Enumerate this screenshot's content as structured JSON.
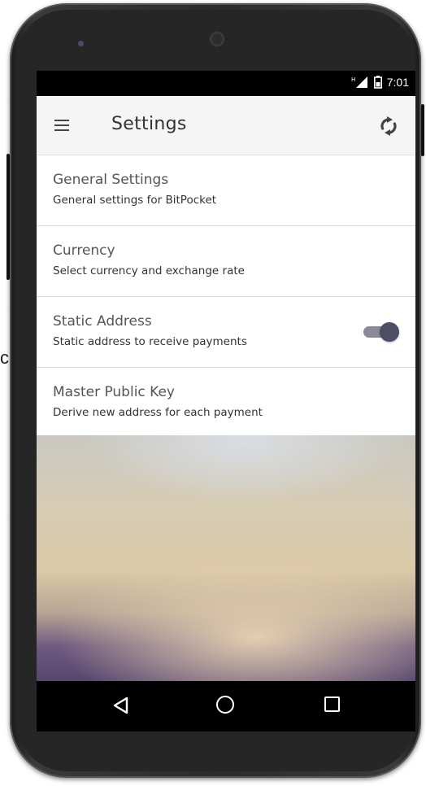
{
  "status_bar": {
    "time": "7:01",
    "signal_icon": "signal-icon",
    "battery_icon": "battery-icon"
  },
  "app_bar": {
    "title": "Settings",
    "menu_icon": "hamburger-menu-icon",
    "action_icon": "refresh-icon"
  },
  "settings": [
    {
      "title": "General Settings",
      "subtitle": "General settings for BitPocket"
    },
    {
      "title": "Currency",
      "subtitle": "Select currency and exchange rate"
    },
    {
      "title": "Static Address",
      "subtitle": "Static address to receive payments",
      "toggle_on": true
    },
    {
      "title": "Master Public Key",
      "subtitle": "Derive new address for each payment"
    }
  ],
  "nav_bar": {
    "back_icon": "back-triangle-icon",
    "home_icon": "home-circle-icon",
    "recents_icon": "recents-square-icon"
  },
  "page_edge_char": "c",
  "colors": {
    "app_bar_bg": "#f5f5f5",
    "toggle_thumb": "#4d4d64",
    "toggle_track": "#8a8a99",
    "title_text": "#555555",
    "subtitle_text": "#333333"
  }
}
